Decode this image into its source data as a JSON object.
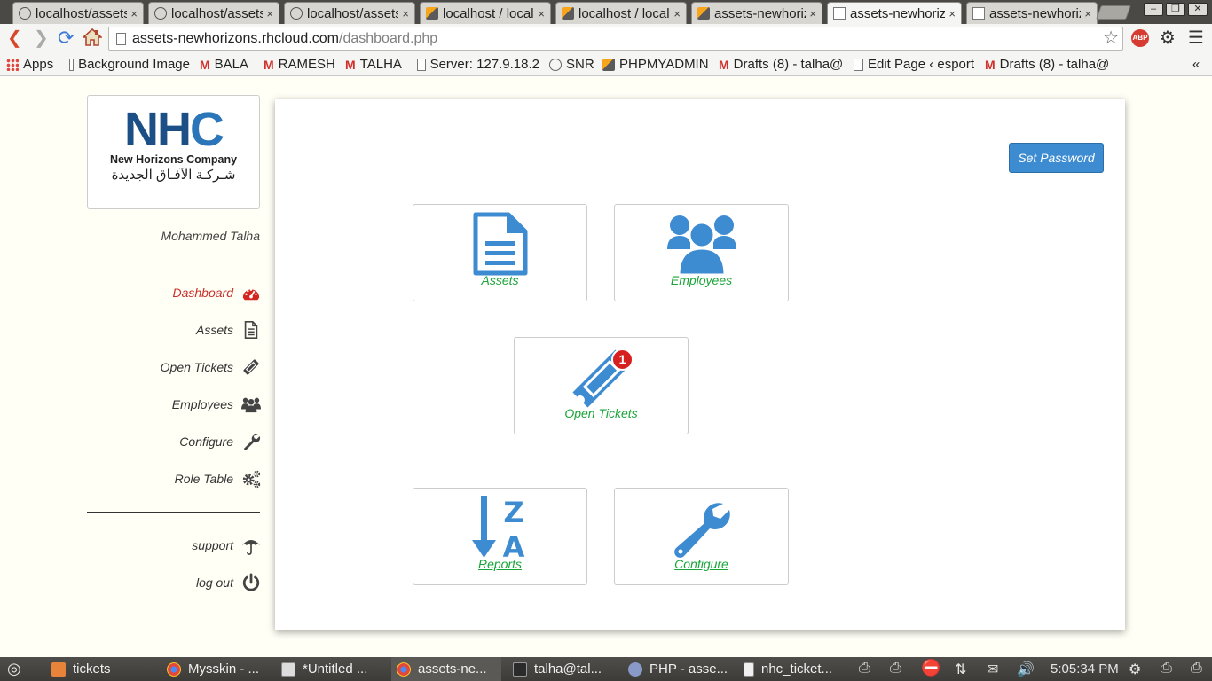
{
  "browser": {
    "tabs": [
      {
        "title": "localhost/assets",
        "favicon": "globe-icon"
      },
      {
        "title": "localhost/assets",
        "favicon": "globe-icon"
      },
      {
        "title": "localhost/assets",
        "favicon": "globe-icon"
      },
      {
        "title": "localhost / localhost",
        "favicon": "phpmyadmin-icon"
      },
      {
        "title": "localhost / localhost",
        "favicon": "phpmyadmin-icon"
      },
      {
        "title": "assets-newhorizons",
        "favicon": "phpmyadmin-icon"
      },
      {
        "title": "assets-newhorizons",
        "favicon": "page-icon",
        "active": true
      },
      {
        "title": "assets-newhorizons",
        "favicon": "page-icon"
      }
    ],
    "tab_close": "×",
    "window_buttons": {
      "minimize": "–",
      "restore": "❐",
      "close": "✕"
    },
    "url_host": "assets-newhorizons.rhcloud.com",
    "url_path": "/dashboard.php",
    "abp_label": "ABP",
    "bookmarks": [
      {
        "label": "Apps",
        "icon": "apps-icon"
      },
      {
        "label": "Background Image",
        "icon": "page-icon"
      },
      {
        "label": "BALA",
        "icon": "gmail-icon"
      },
      {
        "label": "RAMESH",
        "icon": "gmail-icon"
      },
      {
        "label": "TALHA",
        "icon": "gmail-icon"
      },
      {
        "label": "Server: 127.9.18.2",
        "icon": "page-icon"
      },
      {
        "label": "SNR",
        "icon": "ring-icon"
      },
      {
        "label": "PHPMYADMIN",
        "icon": "phpmyadmin-icon"
      },
      {
        "label": "Drafts (8) - talha@",
        "icon": "gmail-icon"
      },
      {
        "label": "Edit Page ‹ esport",
        "icon": "page-icon"
      },
      {
        "label": "Drafts (8) - talha@",
        "icon": "gmail-icon"
      }
    ],
    "bookmarks_overflow": "«"
  },
  "logo": {
    "mark_n": "NH",
    "mark_c": "C",
    "english": "New Horizons Company",
    "arabic": "شـركـة الآفـاق الجديدة"
  },
  "user": {
    "name": "Mohammed Talha"
  },
  "sidebar": {
    "items": [
      {
        "label": "Dashboard",
        "icon": "dashboard-icon",
        "current": true
      },
      {
        "label": "Assets",
        "icon": "document-icon"
      },
      {
        "label": "Open Tickets",
        "icon": "ticket-icon"
      },
      {
        "label": "Employees",
        "icon": "users-icon"
      },
      {
        "label": "Configure",
        "icon": "wrench-icon"
      },
      {
        "label": "Role Table",
        "icon": "gears-icon"
      }
    ],
    "bottom_items": [
      {
        "label": "support",
        "icon": "umbrella-icon"
      },
      {
        "label": "log out",
        "icon": "power-icon"
      }
    ]
  },
  "main": {
    "set_password_label": "Set Password",
    "tiles": [
      {
        "label": "Assets",
        "icon": "document-icon"
      },
      {
        "label": "Employees",
        "icon": "users-icon"
      },
      {
        "label": "Open Tickets",
        "icon": "ticket-icon",
        "badge": "1"
      },
      {
        "label": "Reports",
        "icon": "sort-alpha-desc-icon",
        "icon_letters_top": "Z",
        "icon_letters_bottom": "A"
      },
      {
        "label": "Configure",
        "icon": "wrench-icon"
      }
    ]
  },
  "taskbar": {
    "items": [
      {
        "label": "tickets",
        "icon": "folder-icon"
      },
      {
        "label": "Mysskin - ...",
        "icon": "chrome-icon"
      },
      {
        "label": "*Untitled ...",
        "icon": "text-editor-icon"
      },
      {
        "label": "assets-ne...",
        "icon": "chrome-icon",
        "active": true
      },
      {
        "label": "talha@tal...",
        "icon": "terminal-icon"
      },
      {
        "label": "PHP - asse...",
        "icon": "php-icon"
      },
      {
        "label": "nhc_ticket...",
        "icon": "document-icon"
      }
    ],
    "clock": "5:05:34 PM"
  },
  "colors": {
    "accent_blue": "#3d8bd0",
    "link_green": "#1aa538",
    "active_red": "#c9302c",
    "badge_red": "#d61f1f"
  }
}
